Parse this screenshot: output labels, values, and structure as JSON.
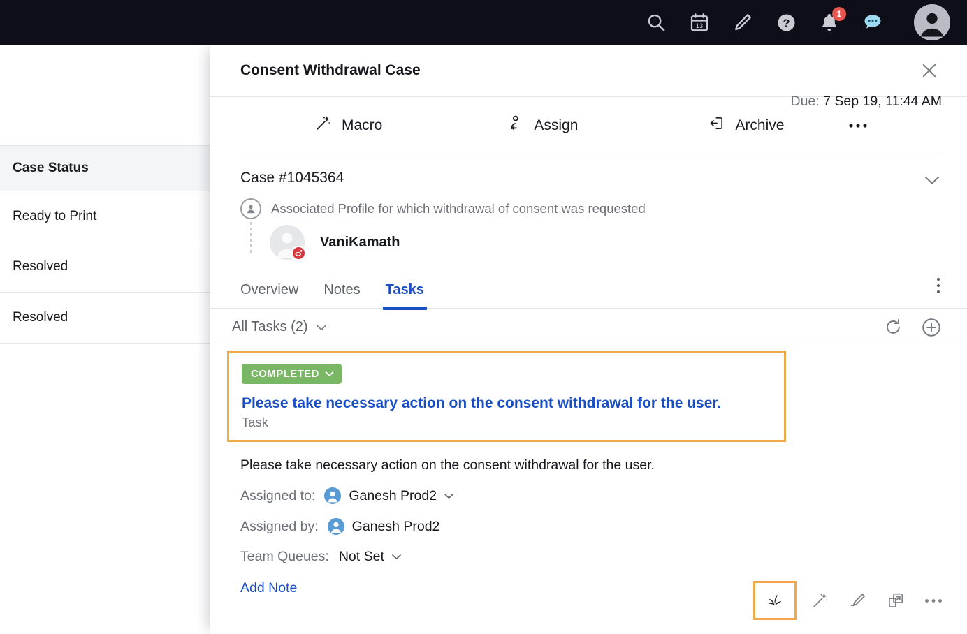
{
  "topbar": {
    "icons": [
      {
        "name": "search-icon",
        "label": "Search"
      },
      {
        "name": "calendar-icon",
        "label": "Calendar",
        "day": "13"
      },
      {
        "name": "compose-pencil-icon",
        "label": "Compose"
      },
      {
        "name": "help-question-icon",
        "label": "Help"
      },
      {
        "name": "notifications-bell-icon",
        "label": "Notifications",
        "badge": "1"
      },
      {
        "name": "messages-chat-icon",
        "label": "Messages"
      },
      {
        "name": "user-avatar-icon",
        "label": "Account"
      }
    ]
  },
  "background_table": {
    "header": "Case Status",
    "rows": [
      "Ready to Print",
      "Resolved",
      "Resolved"
    ]
  },
  "modal": {
    "title": "Consent Withdrawal Case",
    "close_label": "×",
    "actions": {
      "macro": "Macro",
      "assign": "Assign",
      "archive": "Archive",
      "more": "•••"
    },
    "case": {
      "number": "Case #1045364",
      "associated_text": "Associated Profile for which withdrawal of consent was requested",
      "profile_name": "VaniKamath"
    },
    "tabs": [
      {
        "label": "Overview",
        "active": false
      },
      {
        "label": "Notes",
        "active": false
      },
      {
        "label": "Tasks",
        "active": true
      }
    ],
    "filter": {
      "label": "All Tasks (2)"
    },
    "task": {
      "status_badge": "COMPLETED",
      "title": "Please take necessary action on the consent withdrawal for the user.",
      "type": "Task",
      "due_label": "Due:",
      "due_value": "7 Sep 19, 11:44 AM",
      "description": "Please take necessary action on the consent withdrawal for the user.",
      "assigned_to_label": "Assigned to:",
      "assigned_to_value": "Ganesh Prod2",
      "assigned_by_label": "Assigned by:",
      "assigned_by_value": "Ganesh Prod2",
      "team_queues_label": "Team Queues:",
      "team_queues_value": "Not Set",
      "add_note": "Add Note"
    },
    "bottom_actions": [
      {
        "name": "sprout-leaves-icon",
        "highlighted": true
      },
      {
        "name": "magic-wand-icon",
        "highlighted": false
      },
      {
        "name": "highlighter-pen-icon",
        "highlighted": false
      },
      {
        "name": "open-external-icon",
        "highlighted": false
      },
      {
        "name": "more-horizontal-icon",
        "highlighted": false
      }
    ]
  },
  "colors": {
    "topbar_bg": "#0d0e17",
    "accent_blue": "#1a4fc4",
    "badge_green": "#79b765",
    "highlight_orange": "#efa949",
    "notification_red": "#e8564f",
    "muted_text": "#6d7078"
  }
}
